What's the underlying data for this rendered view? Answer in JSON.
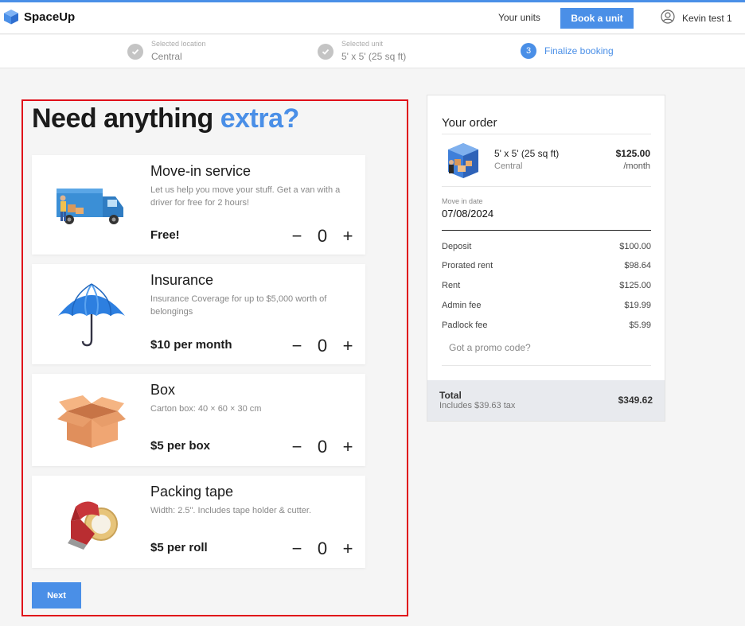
{
  "app": {
    "name": "SpaceUp",
    "colors": {
      "accent": "#4a8fe7",
      "highlight_border": "#e0101a"
    }
  },
  "nav": {
    "your_units": "Your units",
    "book_unit": "Book a unit",
    "user_name": "Kevin test 1"
  },
  "steps": [
    {
      "small_label": "Selected location",
      "value": "Central",
      "state": "done"
    },
    {
      "small_label": "Selected unit",
      "value": "5' x 5' (25 sq ft)",
      "state": "done"
    },
    {
      "number": "3",
      "label": "Finalize booking",
      "state": "active"
    }
  ],
  "heading": {
    "main": "Need anything",
    "accent": "extra?"
  },
  "extras": [
    {
      "title": "Move-in service",
      "description": "Let us help you move your stuff. Get a van with a driver for free for 2 hours!",
      "price": "Free!",
      "quantity": "0",
      "icon": "moving-van-icon"
    },
    {
      "title": "Insurance",
      "description": "Insurance Coverage for up to $5,000 worth of belongings",
      "price": "$10 per month",
      "quantity": "0",
      "icon": "umbrella-icon"
    },
    {
      "title": "Box",
      "description": "Carton box: 40 × 60 × 30 cm",
      "price": "$5 per box",
      "quantity": "0",
      "icon": "box-icon"
    },
    {
      "title": "Packing tape",
      "description": "Width: 2.5\". Includes tape holder & cutter.",
      "price": "$5 per roll",
      "quantity": "0",
      "icon": "tape-dispenser-icon"
    }
  ],
  "qty_controls": {
    "minus": "−",
    "plus": "+"
  },
  "next_label": "Next",
  "order": {
    "title": "Your order",
    "unit": {
      "name": "5' x 5' (25 sq ft)",
      "location": "Central",
      "price": "$125.00",
      "per": "/month"
    },
    "move_in_label": "Move in date",
    "move_in_date": "07/08/2024",
    "fees": [
      {
        "label": "Deposit",
        "amount": "$100.00"
      },
      {
        "label": "Prorated rent",
        "amount": "$98.64"
      },
      {
        "label": "Rent",
        "amount": "$125.00"
      },
      {
        "label": "Admin fee",
        "amount": "$19.99"
      },
      {
        "label": "Padlock fee",
        "amount": "$5.99"
      }
    ],
    "promo": "Got a promo code?",
    "total_label": "Total",
    "tax_note": "Includes $39.63 tax",
    "total": "$349.62"
  }
}
